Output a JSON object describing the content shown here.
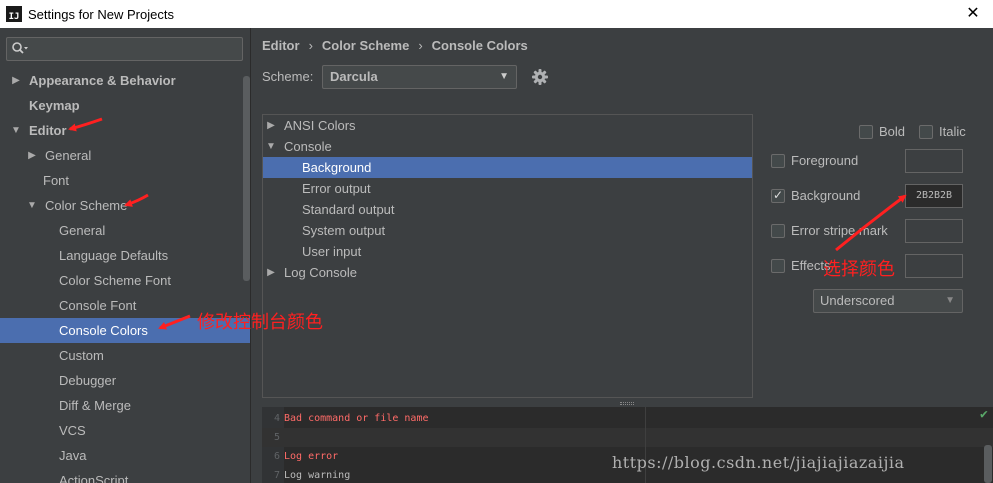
{
  "window": {
    "title": "Settings for New Projects",
    "app_icon_text": "IJ",
    "close_glyph": "✕"
  },
  "sidebar": {
    "search": {
      "placeholder": "",
      "value": ""
    },
    "items": [
      {
        "label": "Appearance & Behavior",
        "level": 0,
        "arrow": "▶",
        "bold": true
      },
      {
        "label": "Keymap",
        "level": 0,
        "arrow": "",
        "bold": true
      },
      {
        "label": "Editor",
        "level": 0,
        "arrow": "▼",
        "bold": true
      },
      {
        "label": "General",
        "level": 1,
        "arrow": "▶"
      },
      {
        "label": "Font",
        "level": 1,
        "arrow": ""
      },
      {
        "label": "Color Scheme",
        "level": 1,
        "arrow": "▼"
      },
      {
        "label": "General",
        "level": 2,
        "arrow": ""
      },
      {
        "label": "Language Defaults",
        "level": 2,
        "arrow": ""
      },
      {
        "label": "Color Scheme Font",
        "level": 2,
        "arrow": ""
      },
      {
        "label": "Console Font",
        "level": 2,
        "arrow": ""
      },
      {
        "label": "Console Colors",
        "level": 2,
        "arrow": "",
        "selected": true
      },
      {
        "label": "Custom",
        "level": 2,
        "arrow": ""
      },
      {
        "label": "Debugger",
        "level": 2,
        "arrow": ""
      },
      {
        "label": "Diff & Merge",
        "level": 2,
        "arrow": ""
      },
      {
        "label": "VCS",
        "level": 2,
        "arrow": ""
      },
      {
        "label": "Java",
        "level": 2,
        "arrow": ""
      },
      {
        "label": "ActionScript",
        "level": 2,
        "arrow": ""
      }
    ]
  },
  "breadcrumb": {
    "items": [
      "Editor",
      "Color Scheme",
      "Console Colors"
    ],
    "separator": "›"
  },
  "scheme": {
    "label": "Scheme:",
    "value": "Darcula",
    "dropdown_glyph": "▼"
  },
  "elements": [
    {
      "label": "ANSI Colors",
      "level": 0,
      "arrow": "▶"
    },
    {
      "label": "Console",
      "level": 0,
      "arrow": "▼"
    },
    {
      "label": "Background",
      "level": 1,
      "arrow": "",
      "selected": true
    },
    {
      "label": "Error output",
      "level": 1,
      "arrow": ""
    },
    {
      "label": "Standard output",
      "level": 1,
      "arrow": ""
    },
    {
      "label": "System output",
      "level": 1,
      "arrow": ""
    },
    {
      "label": "User input",
      "level": 1,
      "arrow": ""
    },
    {
      "label": "Log Console",
      "level": 0,
      "arrow": "▶"
    }
  ],
  "options": {
    "bold_label": "Bold",
    "italic_label": "Italic",
    "foreground_label": "Foreground",
    "background_label": "Background",
    "background_value": "2B2B2B",
    "error_stripe_label": "Error stripe mark",
    "effects_label": "Effects",
    "effects_type": "Underscored",
    "effects_dropdown_glyph": "▼"
  },
  "preview": {
    "lines": [
      {
        "num": "4",
        "text": "Bad command or file name",
        "color": "#ff6b68"
      },
      {
        "num": "5",
        "text": "",
        "color": "#bbbbbb"
      },
      {
        "num": "6",
        "text": "Log error",
        "color": "#ff6b68"
      },
      {
        "num": "7",
        "text": "Log warning",
        "color": "#bbbbbb"
      }
    ],
    "status_glyph": "✔"
  },
  "annotations": {
    "modify_console": "修改控制台颜色",
    "choose_color": "选择颜色"
  },
  "watermark": "https://blog.csdn.net/jiajiajiazaijia",
  "colors": {
    "bg": "#3c3f41",
    "selection": "#4b6eaf",
    "editor_bg": "#2b2b2b",
    "annotation_red": "#ff2020"
  }
}
